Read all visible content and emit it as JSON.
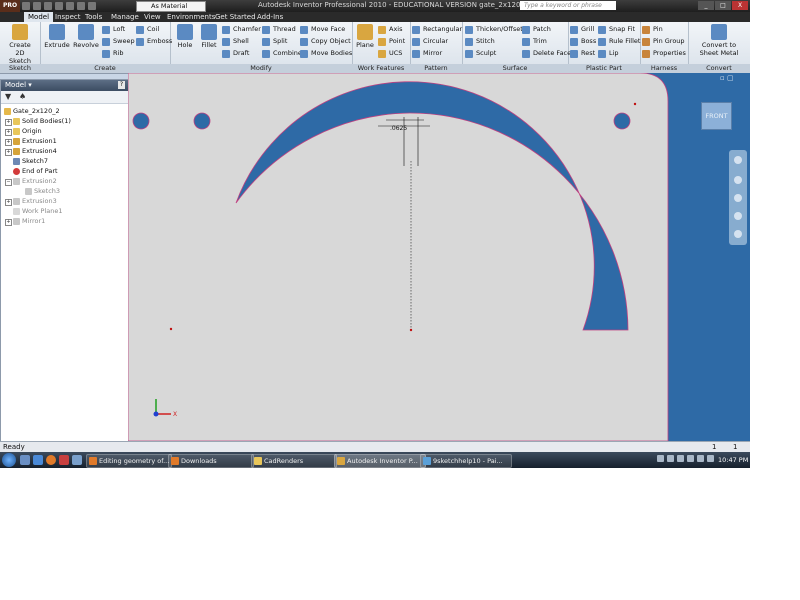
{
  "titlebar": {
    "app_button": "PRO",
    "title": "Autodesk Inventor Professional 2010 - EDUCATIONAL VERSION    gate_2x120",
    "material": "As Material",
    "search_placeholder": "Type a keyword or phrase",
    "min": "_",
    "max": "□",
    "close": "X"
  },
  "ribbon_tabs": [
    "Model",
    "Inspect",
    "Tools",
    "Manage",
    "View",
    "Environments",
    "Get Started",
    "Add-Ins"
  ],
  "ribbon": {
    "sketch": {
      "title": "Sketch",
      "create_2d_sketch": "Create\n2D Sketch"
    },
    "create": {
      "title": "Create",
      "extrude": "Extrude",
      "revolve": "Revolve",
      "loft": "Loft",
      "sweep": "Sweep",
      "rib": "Rib",
      "coil": "Coil",
      "emboss": "Emboss"
    },
    "modify": {
      "title": "Modify",
      "hole": "Hole",
      "fillet": "Fillet",
      "chamfer": "Chamfer",
      "shell": "Shell",
      "draft": "Draft",
      "thread": "Thread",
      "split": "Split",
      "combine": "Combine",
      "move_face": "Move Face",
      "copy_object": "Copy Object",
      "move_bodies": "Move Bodies"
    },
    "work_features": {
      "title": "Work Features",
      "plane": "Plane",
      "axis": "Axis",
      "point": "Point",
      "ucs": "UCS"
    },
    "pattern": {
      "title": "Pattern",
      "rectangular": "Rectangular",
      "circular": "Circular",
      "mirror": "Mirror"
    },
    "surface": {
      "title": "Surface",
      "thicken_offset": "Thicken/Offset",
      "stitch": "Stitch",
      "sculpt": "Sculpt",
      "patch": "Patch",
      "trim": "Trim",
      "delete_face": "Delete Face"
    },
    "plastic_part": {
      "title": "Plastic Part",
      "grill": "Grill",
      "boss": "Boss",
      "rest": "Rest",
      "snap_fit": "Snap Fit",
      "rule_fillet": "Rule Fillet",
      "lip": "Lip"
    },
    "harness": {
      "title": "Harness",
      "pin": "Pin",
      "pin_group": "Pin Group",
      "properties": "Properties"
    },
    "convert": {
      "title": "Convert",
      "convert_to_sheet_metal": "Convert to\nSheet Metal"
    }
  },
  "browser": {
    "title": "Model ▾",
    "help": "?",
    "items": [
      {
        "label": "Gate_2x120_2",
        "dim": false
      },
      {
        "label": "Solid Bodies(1)",
        "dim": false
      },
      {
        "label": "Origin",
        "dim": false
      },
      {
        "label": "Extrusion1",
        "dim": false
      },
      {
        "label": "Extrusion4",
        "dim": false
      },
      {
        "label": "Sketch7",
        "dim": false
      },
      {
        "label": "End of Part",
        "dim": false
      },
      {
        "label": "Extrusion2",
        "dim": true
      },
      {
        "label": "Sketch3",
        "dim": true
      },
      {
        "label": "Extrusion3",
        "dim": true
      },
      {
        "label": "Work Plane1",
        "dim": true
      },
      {
        "label": "Mirror1",
        "dim": true
      }
    ]
  },
  "viewport": {
    "viewcube_label": "FRONT",
    "dimension_text": ".0625",
    "axis_x": "X",
    "background": "#2e6aa6",
    "part_color": "#d8d8d8"
  },
  "statusbar": {
    "status": "Ready",
    "count1": "1",
    "count2": "1"
  },
  "taskbar": {
    "tasks": [
      {
        "label": "Editing geometry of..."
      },
      {
        "label": "Downloads"
      },
      {
        "label": "CadRenders"
      },
      {
        "label": "Autodesk Inventor P..."
      },
      {
        "label": "9sketchhelp10 - Pai..."
      }
    ],
    "clock": "10:47 PM"
  }
}
